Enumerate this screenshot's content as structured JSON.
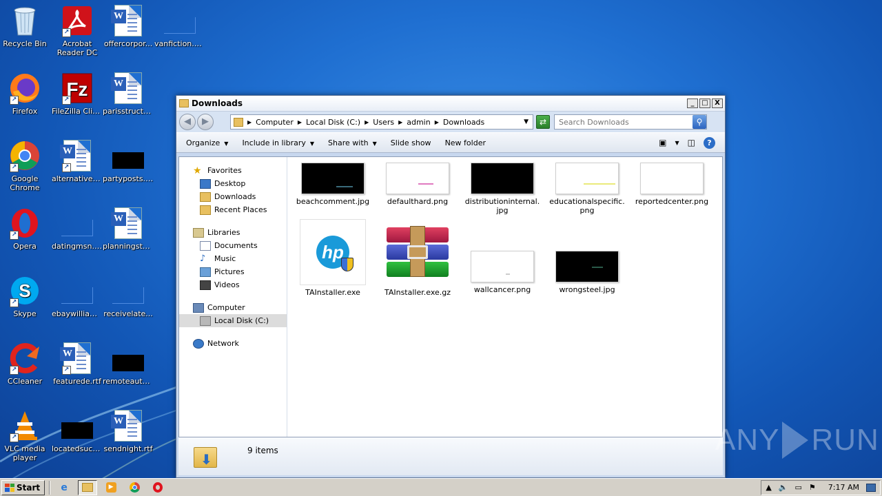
{
  "desktop": {
    "icons": [
      {
        "label": "Recycle Bin"
      },
      {
        "label": "Acrobat Reader DC"
      },
      {
        "label": "offercorpor..."
      },
      {
        "label": "vanfiction.png"
      },
      {
        "label": "Firefox"
      },
      {
        "label": "FileZilla Client"
      },
      {
        "label": "parisstructu..."
      },
      {
        "label": "Google Chrome"
      },
      {
        "label": "alternativep..."
      },
      {
        "label": "partyposts.jpg"
      },
      {
        "label": "Opera"
      },
      {
        "label": "datingmsn.png"
      },
      {
        "label": "planningstyl..."
      },
      {
        "label": "Skype"
      },
      {
        "label": "ebaywilliam...."
      },
      {
        "label": "receivelate..."
      },
      {
        "label": "CCleaner"
      },
      {
        "label": "featurede.rtf"
      },
      {
        "label": "remoteauto..."
      },
      {
        "label": "VLC media player"
      },
      {
        "label": "locatedsuch..."
      },
      {
        "label": "sendnight.rtf"
      }
    ]
  },
  "window": {
    "title": "Downloads",
    "controls": {
      "minimize": "_",
      "maximize": "□",
      "close": "X"
    },
    "breadcrumb": [
      "Computer",
      "Local Disk (C:)",
      "Users",
      "admin",
      "Downloads"
    ],
    "search_placeholder": "Search Downloads",
    "toolbar": {
      "organize": "Organize",
      "include": "Include in library",
      "share": "Share with",
      "slideshow": "Slide show",
      "newfolder": "New folder"
    },
    "nav": {
      "favorites": "Favorites",
      "desktop": "Desktop",
      "downloads": "Downloads",
      "recent": "Recent Places",
      "libraries": "Libraries",
      "documents": "Documents",
      "music": "Music",
      "pictures": "Pictures",
      "videos": "Videos",
      "computer": "Computer",
      "localdisk": "Local Disk (C:)",
      "network": "Network"
    },
    "files": [
      {
        "name": "beachcomment.jpg"
      },
      {
        "name": "defaulthard.png"
      },
      {
        "name": "distributioninternal.\njpg"
      },
      {
        "name": "educationalspecific.\npng"
      },
      {
        "name": "reportedcenter.png"
      },
      {
        "name": "TAInstaller.exe"
      },
      {
        "name": "TAInstaller.exe.gz"
      },
      {
        "name": "wallcancer.png"
      },
      {
        "name": "wrongsteel.jpg"
      }
    ],
    "status": {
      "count": "9 items"
    }
  },
  "taskbar": {
    "start": "Start",
    "clock": "7:17 AM"
  },
  "watermark": {
    "left": "ANY",
    "right": "RUN"
  }
}
